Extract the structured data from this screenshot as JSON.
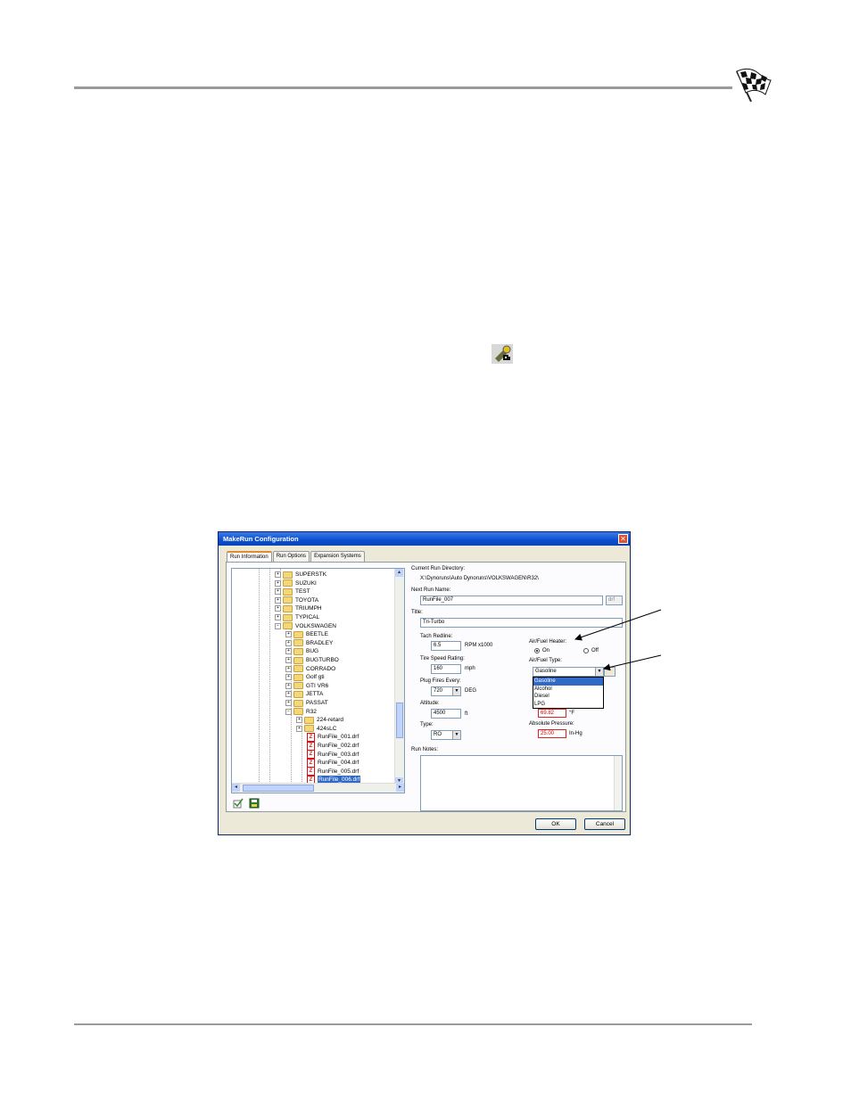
{
  "icons": {
    "header_logo": "checkered-flag-icon",
    "toolbar_button": "run-configuration-icon",
    "close": "close-icon",
    "tree_toolbar": [
      "check-icon",
      "save-icon"
    ]
  },
  "dialog": {
    "title": "MakeRun Configuration",
    "close_glyph": "✕",
    "tabs": [
      "Run Information",
      "Run Options",
      "Expansion Systems"
    ],
    "tree": {
      "items": [
        {
          "label": "SUPERSTK",
          "kind": "folder",
          "exp": "+"
        },
        {
          "label": "SUZUKI",
          "kind": "folder",
          "exp": "+"
        },
        {
          "label": "TEST",
          "kind": "folder",
          "exp": "+"
        },
        {
          "label": "TOYOTA",
          "kind": "folder",
          "exp": "+"
        },
        {
          "label": "TRIUMPH",
          "kind": "folder",
          "exp": "+"
        },
        {
          "label": "TYPICAL",
          "kind": "folder",
          "exp": "+"
        },
        {
          "label": "VOLKSWAGEN",
          "kind": "folder",
          "exp": "−"
        },
        {
          "label": "BEETLE",
          "kind": "folder",
          "exp": "+"
        },
        {
          "label": "BRADLEY",
          "kind": "folder",
          "exp": "+"
        },
        {
          "label": "BUG",
          "kind": "folder",
          "exp": "+"
        },
        {
          "label": "BUGTURBO",
          "kind": "folder",
          "exp": "+"
        },
        {
          "label": "CORRADO",
          "kind": "folder",
          "exp": "+"
        },
        {
          "label": "Golf gti",
          "kind": "folder",
          "exp": "+"
        },
        {
          "label": "GTI VR6",
          "kind": "folder",
          "exp": "+"
        },
        {
          "label": "JETTA",
          "kind": "folder",
          "exp": "+"
        },
        {
          "label": "PASSAT",
          "kind": "folder",
          "exp": "+"
        },
        {
          "label": "R32",
          "kind": "folder",
          "exp": "−"
        },
        {
          "label": "224-retard",
          "kind": "folder",
          "exp": "+"
        },
        {
          "label": "424sLC",
          "kind": "folder",
          "exp": "+"
        },
        {
          "label": "RunFile_001.drf",
          "kind": "file",
          "exp": ""
        },
        {
          "label": "RunFile_002.drf",
          "kind": "file",
          "exp": ""
        },
        {
          "label": "RunFile_003.drf",
          "kind": "file",
          "exp": ""
        },
        {
          "label": "RunFile_004.drf",
          "kind": "file",
          "exp": ""
        },
        {
          "label": "RunFile_005.drf",
          "kind": "file",
          "exp": ""
        },
        {
          "label": "RunFile_006.drf",
          "kind": "file",
          "exp": "",
          "selected": true
        }
      ]
    },
    "form": {
      "current_dir_label": "Current Run Directory:",
      "current_dir_value": "X:\\Dynoruns\\Auto Dynoruns\\VOLKSWAGEN\\R32\\",
      "next_run_label": "Next Run Name:",
      "next_run_value": "RunFile_007",
      "next_run_ext": "drf",
      "title_label": "Title:",
      "title_value": "Tri-Turbo",
      "tach_label": "Tach Redline:",
      "tach_value": "6.5",
      "tach_unit": "RPM x1000",
      "tire_label": "Tire Speed Rating:",
      "tire_value": "160",
      "tire_unit": "mph",
      "plug_label": "Plug Fires Every:",
      "plug_value": "720",
      "plug_unit": "DEG",
      "altitude_label": "Altitude:",
      "altitude_value": "4500",
      "altitude_unit": "ft",
      "type_label": "Type:",
      "type_value": "RO",
      "heater_label": "Air/Fuel Heater:",
      "heater_on": "On",
      "heater_off": "Off",
      "fuel_type_label": "Air/Fuel Type:",
      "fuel_type_value": "Gasoline",
      "fuel_options": [
        "Gasoline",
        "Alcohol",
        "Diesel",
        "LPG"
      ],
      "temp_value": "69.82",
      "temp_unit": "°F",
      "pressure_label": "Absolute Pressure:",
      "pressure_value": "25.00",
      "pressure_unit": "In-Hg",
      "notes_label": "Run Notes:"
    },
    "ok_label": "OK",
    "cancel_label": "Cancel"
  }
}
